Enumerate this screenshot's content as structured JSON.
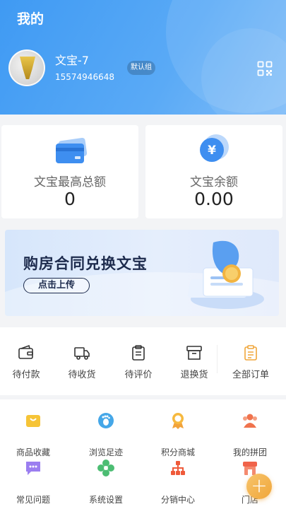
{
  "header": {
    "title": "我的",
    "username": "文宝-7",
    "phone": "15574946648",
    "group_badge": "默认组"
  },
  "stats": {
    "max_total_label": "文宝最高总额",
    "max_total_value": "0",
    "balance_label": "文宝余额",
    "balance_value": "0.00"
  },
  "banner": {
    "title": "购房合同兑换文宝",
    "button_label": "点击上传"
  },
  "orders": [
    {
      "label": "待付款",
      "icon": "wallet-icon"
    },
    {
      "label": "待收货",
      "icon": "truck-icon"
    },
    {
      "label": "待评价",
      "icon": "clipboard-icon"
    },
    {
      "label": "退换货",
      "icon": "box-icon"
    },
    {
      "label": "全部订单",
      "icon": "order-list-icon"
    }
  ],
  "services": [
    {
      "label": "商品收藏",
      "icon": "favorites-bag-icon"
    },
    {
      "label": "浏览足迹",
      "icon": "footprint-icon"
    },
    {
      "label": "积分商城",
      "icon": "medal-icon"
    },
    {
      "label": "我的拼团",
      "icon": "group-people-icon"
    },
    {
      "label": "常见问题",
      "icon": "chat-question-icon"
    },
    {
      "label": "系统设置",
      "icon": "settings-flower-icon"
    },
    {
      "label": "分销中心",
      "icon": "distribution-icon"
    },
    {
      "label": "门店",
      "icon": "store-icon"
    }
  ],
  "colors": {
    "header_blue": "#4aa0f5",
    "accent_orange": "#f0a63a"
  }
}
